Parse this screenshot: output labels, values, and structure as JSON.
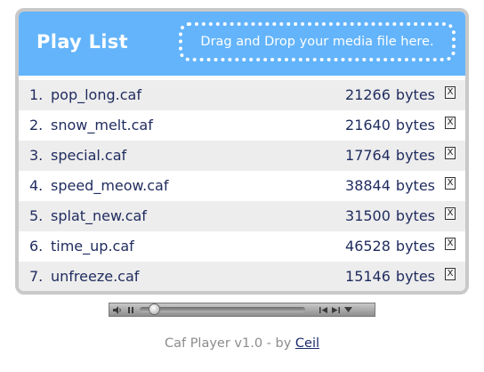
{
  "header": {
    "title": "Play List",
    "dropzone_text": "Drag and Drop your media file here."
  },
  "playlist": {
    "unit": "bytes",
    "remove_label": "X",
    "items": [
      {
        "num": "1.",
        "name": "pop_long.caf",
        "size": "21266"
      },
      {
        "num": "2.",
        "name": "snow_melt.caf",
        "size": "21640"
      },
      {
        "num": "3.",
        "name": "special.caf",
        "size": "17764"
      },
      {
        "num": "4.",
        "name": "speed_meow.caf",
        "size": "38844"
      },
      {
        "num": "5.",
        "name": "splat_new.caf",
        "size": "31500"
      },
      {
        "num": "6.",
        "name": "time_up.caf",
        "size": "46528"
      },
      {
        "num": "7.",
        "name": "unfreeze.caf",
        "size": "15146"
      }
    ]
  },
  "player": {
    "progress": 0.06,
    "icons": [
      "speaker-icon",
      "pause-icon",
      "rewind-icon",
      "fast-forward-icon",
      "dropdown-icon"
    ]
  },
  "footer": {
    "prefix": "Caf Player v1.0 - by ",
    "author": "Ceil"
  },
  "colors": {
    "header": "#63b4fb",
    "border": "#c9c9c9",
    "row_alt": "#ededed",
    "text": "#1f2b5e"
  }
}
